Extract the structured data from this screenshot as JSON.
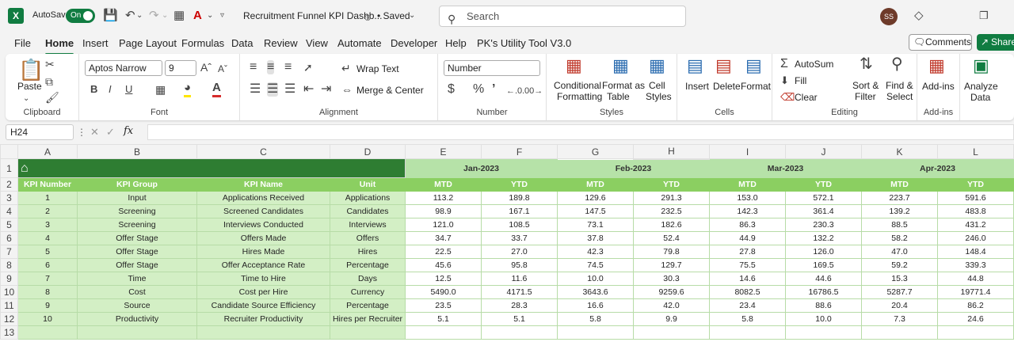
{
  "titlebar": {
    "autosave_label": "AutoSave",
    "autosave_state": "On",
    "doc_title": "Recruitment Funnel KPI Dashb...",
    "saved_status": "• Saved",
    "search_placeholder": "Search",
    "user_initials": "SS"
  },
  "menu": {
    "items": [
      "File",
      "Home",
      "Insert",
      "Page Layout",
      "Formulas",
      "Data",
      "Review",
      "View",
      "Automate",
      "Developer",
      "Help",
      "PK's Utility Tool V3.0"
    ],
    "active": "Home",
    "comments_label": "Comments",
    "share_label": "Share"
  },
  "ribbon": {
    "clipboard": {
      "paste": "Paste",
      "label": "Clipboard"
    },
    "font": {
      "name": "Aptos Narrow",
      "size": "9",
      "label": "Font",
      "font_color": "#d62c2c",
      "fill_color": "#ffe600"
    },
    "alignment": {
      "wrap": "Wrap Text",
      "merge": "Merge & Center",
      "label": "Alignment"
    },
    "number": {
      "format": "Number",
      "label": "Number"
    },
    "styles": {
      "conditional": "Conditional",
      "conditional2": "Formatting",
      "format_table": "Format as",
      "format_table2": "Table",
      "cell_styles": "Cell",
      "cell_styles2": "Styles",
      "label": "Styles"
    },
    "cells": {
      "insert": "Insert",
      "delete": "Delete",
      "format": "Format",
      "label": "Cells"
    },
    "editing": {
      "autosum": "AutoSum",
      "fill": "Fill",
      "clear": "Clear",
      "sort": "Sort &",
      "sort2": "Filter",
      "find": "Find &",
      "find2": "Select",
      "label": "Editing"
    },
    "addins": {
      "addins": "Add-ins",
      "label": "Add-ins",
      "analyze": "Analyze",
      "analyze2": "Data"
    }
  },
  "formula_bar": {
    "cell_ref": "H24",
    "fx": "fx",
    "content": ""
  },
  "sheet": {
    "columns": [
      "A",
      "B",
      "C",
      "D",
      "E",
      "F",
      "G",
      "H",
      "I",
      "J",
      "K",
      "L"
    ],
    "selected_column": "H",
    "months": [
      "Jan-2023",
      "Feb-2023",
      "Mar-2023",
      "Apr-2023"
    ],
    "headers": [
      "KPI Number",
      "KPI Group",
      "KPI Name",
      "Unit",
      "MTD",
      "YTD",
      "MTD",
      "YTD",
      "MTD",
      "YTD",
      "MTD",
      "YTD"
    ],
    "rows": [
      [
        "1",
        "Input",
        "Applications Received",
        "Applications",
        "113.2",
        "189.8",
        "129.6",
        "291.3",
        "153.0",
        "572.1",
        "223.7",
        "591.6"
      ],
      [
        "2",
        "Screening",
        "Screened Candidates",
        "Candidates",
        "98.9",
        "167.1",
        "147.5",
        "232.5",
        "142.3",
        "361.4",
        "139.2",
        "483.8"
      ],
      [
        "3",
        "Screening",
        "Interviews Conducted",
        "Interviews",
        "121.0",
        "108.5",
        "73.1",
        "182.6",
        "86.3",
        "230.3",
        "88.5",
        "431.2"
      ],
      [
        "4",
        "Offer Stage",
        "Offers Made",
        "Offers",
        "34.7",
        "33.7",
        "37.8",
        "52.4",
        "44.9",
        "132.2",
        "58.2",
        "246.0"
      ],
      [
        "5",
        "Offer Stage",
        "Hires Made",
        "Hires",
        "22.5",
        "27.0",
        "42.3",
        "79.8",
        "27.8",
        "126.0",
        "47.0",
        "148.4"
      ],
      [
        "6",
        "Offer Stage",
        "Offer Acceptance Rate",
        "Percentage",
        "45.6",
        "95.8",
        "74.5",
        "129.7",
        "75.5",
        "169.5",
        "59.2",
        "339.3"
      ],
      [
        "7",
        "Time",
        "Time to Hire",
        "Days",
        "12.5",
        "11.6",
        "10.0",
        "30.3",
        "14.6",
        "44.6",
        "15.3",
        "44.8"
      ],
      [
        "8",
        "Cost",
        "Cost per Hire",
        "Currency",
        "5490.0",
        "4171.5",
        "3643.6",
        "9259.6",
        "8082.5",
        "16786.5",
        "5287.7",
        "19771.4"
      ],
      [
        "9",
        "Source",
        "Candidate Source Efficiency",
        "Percentage",
        "23.5",
        "28.3",
        "16.6",
        "42.0",
        "23.4",
        "88.6",
        "20.4",
        "86.2"
      ],
      [
        "10",
        "Productivity",
        "Recruiter Productivity",
        "Hires per Recruiter",
        "5.1",
        "5.1",
        "5.8",
        "9.9",
        "5.8",
        "10.0",
        "7.3",
        "24.6"
      ]
    ],
    "row_numbers": [
      "1",
      "2",
      "3",
      "4",
      "5",
      "6",
      "7",
      "8",
      "9",
      "10",
      "11",
      "12",
      "13"
    ],
    "colors": {
      "dark_green": "#2e7d32",
      "header_green": "#8bcf61",
      "month_green": "#b6e2a8",
      "light_green": "#d3efc5"
    }
  }
}
